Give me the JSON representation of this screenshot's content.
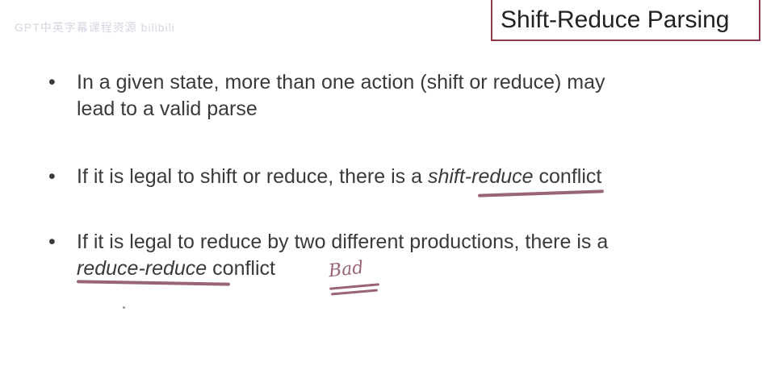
{
  "watermark": "GPT中英字幕课程资源 bilibili",
  "title": "Shift-Reduce Parsing",
  "bullets": [
    {
      "lines": [
        "In a given state, more than one action (shift or reduce) may",
        "lead to a valid parse"
      ]
    },
    {
      "pre": "If it is legal to shift or reduce, there is a ",
      "em": "shift-reduce",
      "post": " conflict"
    },
    {
      "line1": "If it is legal to reduce by two different productions, there is a",
      "em": "reduce-reduce",
      "post": " conflict"
    }
  ],
  "bullet_glyph": "•",
  "annotation": "Bad",
  "ink_color": "#9a6478"
}
